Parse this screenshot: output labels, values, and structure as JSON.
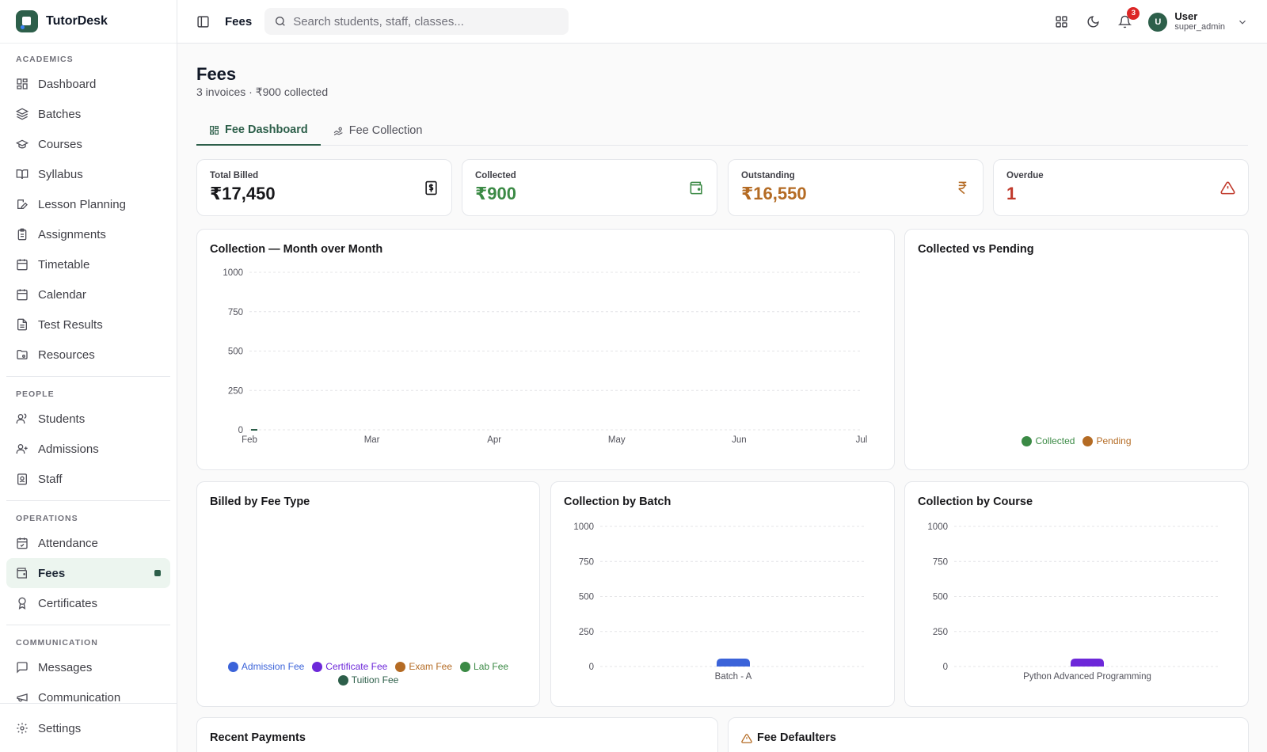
{
  "app": {
    "name": "TutorDesk"
  },
  "colors": {
    "brand": "#2d5f4a",
    "collected": "#3b8a45",
    "pending": "#b46b24",
    "overdue": "#c0392b"
  },
  "sidebar": {
    "sections": [
      {
        "title": "ACADEMICS",
        "items": [
          {
            "label": "Dashboard",
            "icon": "dashboard-icon"
          },
          {
            "label": "Batches",
            "icon": "layers-icon"
          },
          {
            "label": "Courses",
            "icon": "graduation-cap-icon"
          },
          {
            "label": "Syllabus",
            "icon": "book-open-icon"
          },
          {
            "label": "Lesson Planning",
            "icon": "edit-note-icon"
          },
          {
            "label": "Assignments",
            "icon": "clipboard-icon"
          },
          {
            "label": "Timetable",
            "icon": "calendar-icon"
          },
          {
            "label": "Calendar",
            "icon": "calendar-icon"
          },
          {
            "label": "Test Results",
            "icon": "file-text-icon"
          },
          {
            "label": "Resources",
            "icon": "folder-icon"
          }
        ]
      },
      {
        "title": "PEOPLE",
        "items": [
          {
            "label": "Students",
            "icon": "users-icon"
          },
          {
            "label": "Admissions",
            "icon": "user-plus-icon"
          },
          {
            "label": "Staff",
            "icon": "id-badge-icon"
          }
        ]
      },
      {
        "title": "OPERATIONS",
        "items": [
          {
            "label": "Attendance",
            "icon": "calendar-check-icon"
          },
          {
            "label": "Fees",
            "icon": "wallet-icon",
            "active": true
          },
          {
            "label": "Certificates",
            "icon": "award-icon"
          }
        ]
      },
      {
        "title": "COMMUNICATION",
        "items": [
          {
            "label": "Messages",
            "icon": "message-icon"
          },
          {
            "label": "Communication",
            "icon": "megaphone-icon"
          }
        ]
      }
    ],
    "footer": {
      "label": "Settings"
    }
  },
  "topbar": {
    "title": "Fees",
    "search_placeholder": "Search students, staff, classes...",
    "notification_count": "3",
    "user": {
      "initial": "U",
      "name": "User",
      "role": "super_admin"
    }
  },
  "page": {
    "title": "Fees",
    "subtitle": "3 invoices · ₹900 collected",
    "tabs": [
      {
        "label": "Fee Dashboard",
        "active": true
      },
      {
        "label": "Fee Collection",
        "active": false
      }
    ]
  },
  "stats": [
    {
      "label": "Total Billed",
      "value": "₹17,450",
      "icon": "receipt-dollar-icon",
      "color": "#18181b"
    },
    {
      "label": "Collected",
      "value": "₹900",
      "icon": "wallet-icon",
      "color": "#3b8a45"
    },
    {
      "label": "Outstanding",
      "value": "₹16,550",
      "icon": "rupee-icon",
      "color": "#b46b24"
    },
    {
      "label": "Overdue",
      "value": "1",
      "icon": "alert-triangle-icon",
      "color": "#c0392b"
    }
  ],
  "cards": {
    "monthly_title": "Collection — Month over Month",
    "collected_vs_pending_title": "Collected vs Pending",
    "fee_type_title": "Billed by Fee Type",
    "batch_title": "Collection by Batch",
    "course_title": "Collection by Course",
    "recent_payments_title": "Recent Payments",
    "defaulters_title": "Fee Defaulters"
  },
  "chart_data": [
    {
      "type": "line",
      "title": "Collection — Month over Month",
      "categories": [
        "Feb",
        "Mar",
        "Apr",
        "May",
        "Jun",
        "Jul"
      ],
      "series": [
        {
          "values": [
            0
          ]
        }
      ],
      "ylim": [
        0,
        1000
      ],
      "yticks": [
        0,
        250,
        500,
        750,
        1000
      ],
      "grid": true
    },
    {
      "type": "pie",
      "title": "Collected vs Pending",
      "legend": [
        "Collected",
        "Pending"
      ],
      "legend_colors": [
        "#3b8a45",
        "#b46b24"
      ],
      "legend_position": "bottom"
    },
    {
      "type": "pie",
      "title": "Billed by Fee Type",
      "legend": [
        "Admission Fee",
        "Certificate Fee",
        "Exam Fee",
        "Lab Fee",
        "Tuition Fee"
      ],
      "legend_colors": [
        "#3b63d9",
        "#6d28d9",
        "#b46b24",
        "#3b8a45",
        "#2d5f4a"
      ],
      "legend_position": "bottom"
    },
    {
      "type": "bar",
      "title": "Collection by Batch",
      "categories": [
        "Batch - A"
      ],
      "values": [
        0
      ],
      "ylim": [
        0,
        1000
      ],
      "yticks": [
        0,
        250,
        500,
        750,
        1000
      ],
      "bar_color": "#3b63d9"
    },
    {
      "type": "bar",
      "title": "Collection by Course",
      "categories": [
        "Python Advanced Programming"
      ],
      "values": [
        0
      ],
      "ylim": [
        0,
        1000
      ],
      "yticks": [
        0,
        250,
        500,
        750,
        1000
      ],
      "bar_color": "#6d28d9"
    }
  ]
}
